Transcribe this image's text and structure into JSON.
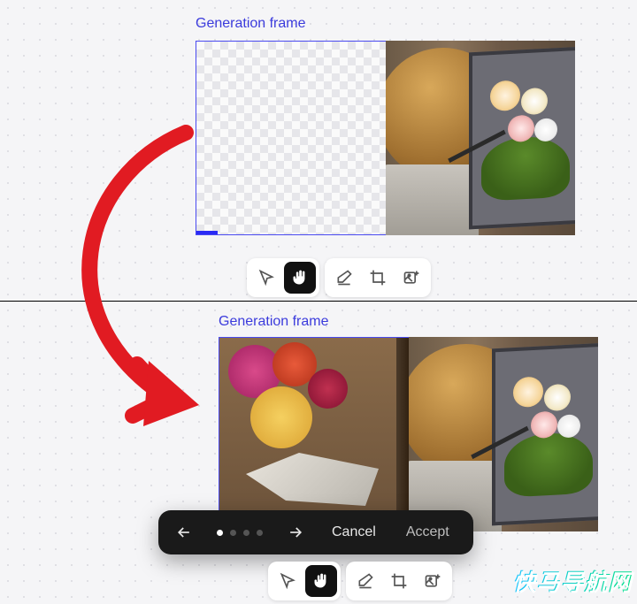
{
  "top": {
    "frame_label": "Generation frame",
    "progress_percent": 11,
    "toolbar": {
      "cursor": "cursor",
      "hand": "hand",
      "eraser": "eraser",
      "crop": "crop",
      "add_image": "add-image",
      "active": "hand"
    }
  },
  "bottom": {
    "frame_label": "Generation frame",
    "review": {
      "prev": "previous",
      "next": "next",
      "dot_count": 4,
      "active_dot": 0,
      "cancel_label": "Cancel",
      "accept_label": "Accept"
    },
    "toolbar": {
      "cursor": "cursor",
      "hand": "hand",
      "eraser": "eraser",
      "crop": "crop",
      "add_image": "add-image",
      "active": "hand"
    }
  },
  "annotation": {
    "arrow_color": "#e11b22"
  },
  "watermark": "快马导航网"
}
